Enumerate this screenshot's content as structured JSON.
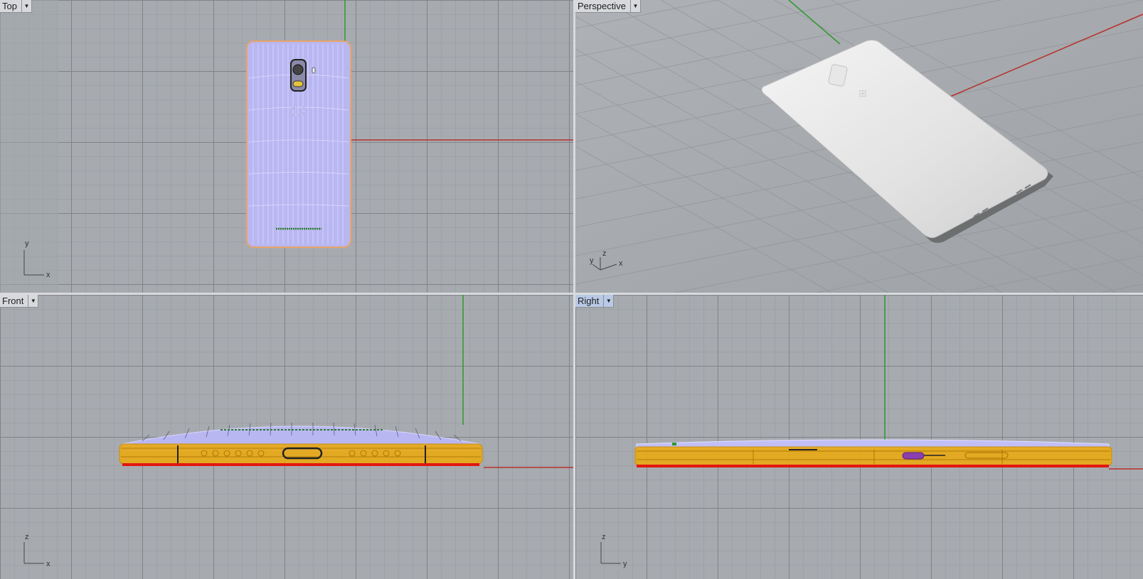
{
  "viewports": {
    "top": {
      "label": "Top",
      "axes": [
        "y",
        "x"
      ]
    },
    "perspective": {
      "label": "Perspective",
      "axes": [
        "y",
        "z",
        "x"
      ]
    },
    "front": {
      "label": "Front",
      "axes": [
        "z",
        "x"
      ]
    },
    "right": {
      "label": "Right",
      "axes": [
        "z",
        "y"
      ],
      "active": true
    }
  },
  "icons": {
    "viewport_menu": "triangle-down-icon"
  },
  "colors": {
    "viewport_bg": "#a7abb0",
    "x_axis": "#b8302c",
    "y_axis": "#2c9a2c",
    "wireframe": "#c9c6f5",
    "selected_body": "#e8a916",
    "bottom_edge": "#e3170f",
    "active_label": "#b9c9e6"
  }
}
